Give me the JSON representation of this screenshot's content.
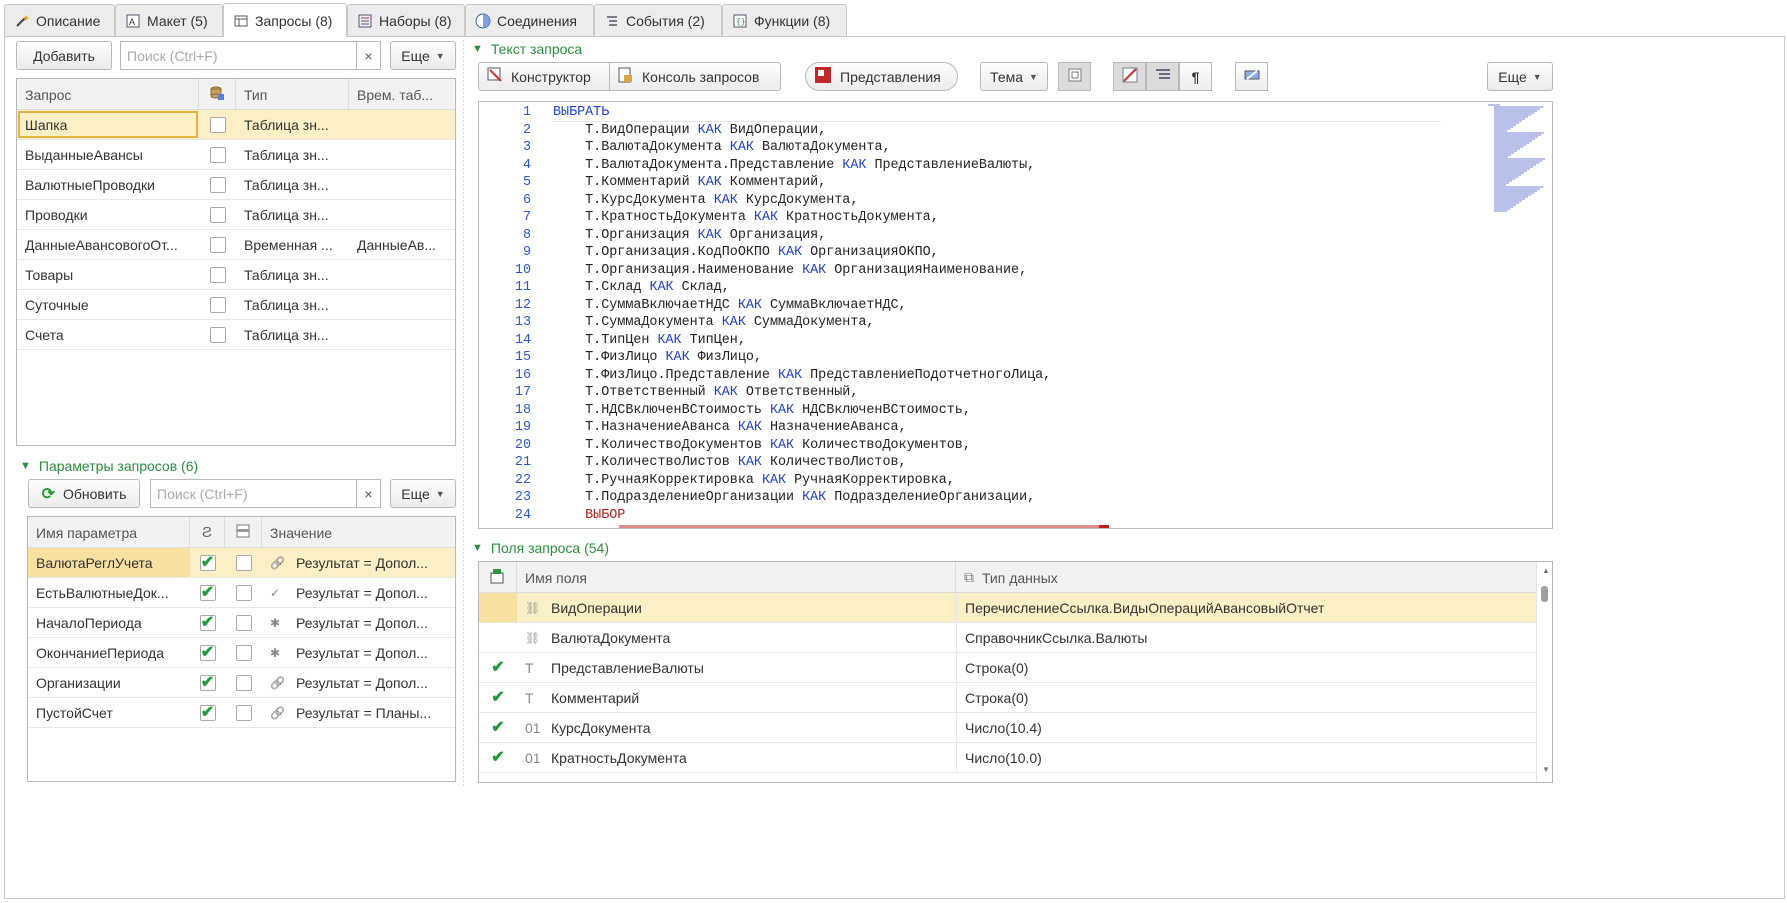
{
  "tabs": [
    {
      "label": "Описание",
      "icon": "wand-icon"
    },
    {
      "label": "Макет (5)",
      "icon": "layout-icon"
    },
    {
      "label": "Запросы (8)",
      "icon": "table-icon"
    },
    {
      "label": "Наборы (8)",
      "icon": "sets-icon"
    },
    {
      "label": "Соединения",
      "icon": "join-icon"
    },
    {
      "label": "События (2)",
      "icon": "events-icon"
    },
    {
      "label": "Функции (8)",
      "icon": "functions-icon"
    }
  ],
  "queries": {
    "add_label": "Добавить",
    "search_placeholder": "Поиск (Ctrl+F)",
    "clear_label": "×",
    "more_label": "Еще",
    "columns": [
      "Запрос",
      "",
      "Тип",
      "Врем. таб..."
    ],
    "rows": [
      {
        "name": "Шапка",
        "checked": false,
        "type": "Таблица зн...",
        "temp": ""
      },
      {
        "name": "ВыданныеАвансы",
        "checked": false,
        "type": "Таблица зн...",
        "temp": ""
      },
      {
        "name": "ВалютныеПроводки",
        "checked": false,
        "type": "Таблица зн...",
        "temp": ""
      },
      {
        "name": "Проводки",
        "checked": false,
        "type": "Таблица зн...",
        "temp": ""
      },
      {
        "name": "ДанныеАвансовогоОт...",
        "checked": false,
        "type": "Временная ...",
        "temp": "ДанныеАв..."
      },
      {
        "name": "Товары",
        "checked": false,
        "type": "Таблица зн...",
        "temp": ""
      },
      {
        "name": "Суточные",
        "checked": false,
        "type": "Таблица зн...",
        "temp": ""
      },
      {
        "name": "Счета",
        "checked": false,
        "type": "Таблица зн...",
        "temp": ""
      }
    ]
  },
  "params": {
    "title": "Параметры запросов (6)",
    "refresh_label": "Обновить",
    "search_placeholder": "Поиск (Ctrl+F)",
    "clear_label": "×",
    "more_label": "Еще",
    "columns": [
      "Имя параметра",
      "",
      "",
      "Значение"
    ],
    "rows": [
      {
        "name": "ВалютаРеглУчета",
        "a": true,
        "b": false,
        "icon": "link-icon",
        "value": "Результат = Допол..."
      },
      {
        "name": "ЕстьВалютныеДок...",
        "a": true,
        "b": false,
        "icon": "check-icon",
        "value": "Результат = Допол..."
      },
      {
        "name": "НачалоПериода",
        "a": true,
        "b": false,
        "icon": "asterisk-icon",
        "value": "Результат = Допол..."
      },
      {
        "name": "ОкончаниеПериода",
        "a": true,
        "b": false,
        "icon": "asterisk-icon",
        "value": "Результат = Допол..."
      },
      {
        "name": "Организации",
        "a": true,
        "b": false,
        "icon": "link-icon",
        "value": "Результат = Допол..."
      },
      {
        "name": "ПустойСчет",
        "a": true,
        "b": false,
        "icon": "link-icon",
        "value": "Результат = Планы..."
      }
    ]
  },
  "query_text": {
    "title": "Текст запроса",
    "constructor_label": "Конструктор",
    "console_label": "Консоль запросов",
    "views_label": "Представления",
    "theme_label": "Тема",
    "more_label": "Еще",
    "pilcrow": "¶",
    "lines": [
      {
        "n": "1",
        "parts": [
          [
            "kw",
            "ВЫБРАТЬ"
          ]
        ]
      },
      {
        "n": "2",
        "parts": [
          [
            "",
            "    Т.ВидОперации "
          ],
          [
            "kw",
            "КАК"
          ],
          [
            "",
            " ВидОперации,"
          ]
        ]
      },
      {
        "n": "3",
        "parts": [
          [
            "",
            "    Т.ВалютаДокумента "
          ],
          [
            "kw",
            "КАК"
          ],
          [
            "",
            " ВалютаДокумента,"
          ]
        ]
      },
      {
        "n": "4",
        "parts": [
          [
            "",
            "    Т.ВалютаДокумента.Представление "
          ],
          [
            "kw",
            "КАК"
          ],
          [
            "",
            " ПредставлениеВалюты,"
          ]
        ]
      },
      {
        "n": "5",
        "parts": [
          [
            "",
            "    Т.Комментарий "
          ],
          [
            "kw",
            "КАК"
          ],
          [
            "",
            " Комментарий,"
          ]
        ]
      },
      {
        "n": "6",
        "parts": [
          [
            "",
            "    Т.КурсДокумента "
          ],
          [
            "kw",
            "КАК"
          ],
          [
            "",
            " КурсДокумента,"
          ]
        ]
      },
      {
        "n": "7",
        "parts": [
          [
            "",
            "    Т.КратностьДокумента "
          ],
          [
            "kw",
            "КАК"
          ],
          [
            "",
            " КратностьДокумента,"
          ]
        ]
      },
      {
        "n": "8",
        "parts": [
          [
            "",
            "    Т.Организация "
          ],
          [
            "kw",
            "КАК"
          ],
          [
            "",
            " Организация,"
          ]
        ]
      },
      {
        "n": "9",
        "parts": [
          [
            "",
            "    Т.Организация.КодПоОКПО "
          ],
          [
            "kw",
            "КАК"
          ],
          [
            "",
            " ОрганизацияОКПО,"
          ]
        ]
      },
      {
        "n": "10",
        "parts": [
          [
            "",
            "    Т.Организация.Наименование "
          ],
          [
            "kw",
            "КАК"
          ],
          [
            "",
            " ОрганизацияНаименование,"
          ]
        ]
      },
      {
        "n": "11",
        "parts": [
          [
            "",
            "    Т.Склад "
          ],
          [
            "kw",
            "КАК"
          ],
          [
            "",
            " Склад,"
          ]
        ]
      },
      {
        "n": "12",
        "parts": [
          [
            "",
            "    Т.СуммаВключаетНДС "
          ],
          [
            "kw",
            "КАК"
          ],
          [
            "",
            " СуммаВключаетНДС,"
          ]
        ]
      },
      {
        "n": "13",
        "parts": [
          [
            "",
            "    Т.СуммаДокумента "
          ],
          [
            "kw",
            "КАК"
          ],
          [
            "",
            " СуммаДокумента,"
          ]
        ]
      },
      {
        "n": "14",
        "parts": [
          [
            "",
            "    Т.ТипЦен "
          ],
          [
            "kw",
            "КАК"
          ],
          [
            "",
            " ТипЦен,"
          ]
        ]
      },
      {
        "n": "15",
        "parts": [
          [
            "",
            "    Т.ФизЛицо "
          ],
          [
            "kw",
            "КАК"
          ],
          [
            "",
            " ФизЛицо,"
          ]
        ]
      },
      {
        "n": "16",
        "parts": [
          [
            "",
            "    Т.ФизЛицо.Представление "
          ],
          [
            "kw",
            "КАК"
          ],
          [
            "",
            " ПредставлениеПодотчетногоЛица,"
          ]
        ]
      },
      {
        "n": "17",
        "parts": [
          [
            "",
            "    Т.Ответственный "
          ],
          [
            "kw",
            "КАК"
          ],
          [
            "",
            " Ответственный,"
          ]
        ]
      },
      {
        "n": "18",
        "parts": [
          [
            "",
            "    Т.НДСВключенВСтоимость "
          ],
          [
            "kw",
            "КАК"
          ],
          [
            "",
            " НДСВключенВСтоимость,"
          ]
        ]
      },
      {
        "n": "19",
        "parts": [
          [
            "",
            "    Т.НазначениеАванса "
          ],
          [
            "kw",
            "КАК"
          ],
          [
            "",
            " НазначениеАванса,"
          ]
        ]
      },
      {
        "n": "20",
        "parts": [
          [
            "",
            "    Т.КоличествоДокументов "
          ],
          [
            "kw",
            "КАК"
          ],
          [
            "",
            " КоличествоДокументов,"
          ]
        ]
      },
      {
        "n": "21",
        "parts": [
          [
            "",
            "    Т.КоличествоЛистов "
          ],
          [
            "kw",
            "КАК"
          ],
          [
            "",
            " КоличествоЛистов,"
          ]
        ]
      },
      {
        "n": "22",
        "parts": [
          [
            "",
            "    Т.РучнаяКорректировка "
          ],
          [
            "kw",
            "КАК"
          ],
          [
            "",
            " РучнаяКорректировка,"
          ]
        ]
      },
      {
        "n": "23",
        "parts": [
          [
            "",
            "    Т.ПодразделениеОрганизации "
          ],
          [
            "kw",
            "КАК"
          ],
          [
            "",
            " ПодразделениеОрганизации,"
          ]
        ]
      },
      {
        "n": "24",
        "parts": [
          [
            "kwr",
            "    ВЫБОР"
          ]
        ]
      }
    ]
  },
  "fields": {
    "title": "Поля запроса (54)",
    "col_name": "Имя поля",
    "col_type": "Тип данных",
    "rows": [
      {
        "check": false,
        "icon": "link-icon",
        "glyph": "⛓",
        "name": "ВидОперации",
        "type": "ПеречислениеСсылка.ВидыОперацийАвансовыйОтчет"
      },
      {
        "check": false,
        "icon": "link-icon",
        "glyph": "⛓",
        "name": "ВалютаДокумента",
        "type": "СправочникСсылка.Валюты"
      },
      {
        "check": true,
        "icon": "text-type-icon",
        "glyph": "T",
        "name": "ПредставлениеВалюты",
        "type": "Строка(0)"
      },
      {
        "check": true,
        "icon": "text-type-icon",
        "glyph": "T",
        "name": "Комментарий",
        "type": "Строка(0)"
      },
      {
        "check": true,
        "icon": "number-type-icon",
        "glyph": "01",
        "name": "КурсДокумента",
        "type": "Число(10.4)"
      },
      {
        "check": true,
        "icon": "number-type-icon",
        "glyph": "01",
        "name": "КратностьДокумента",
        "type": "Число(10.0)"
      }
    ]
  }
}
